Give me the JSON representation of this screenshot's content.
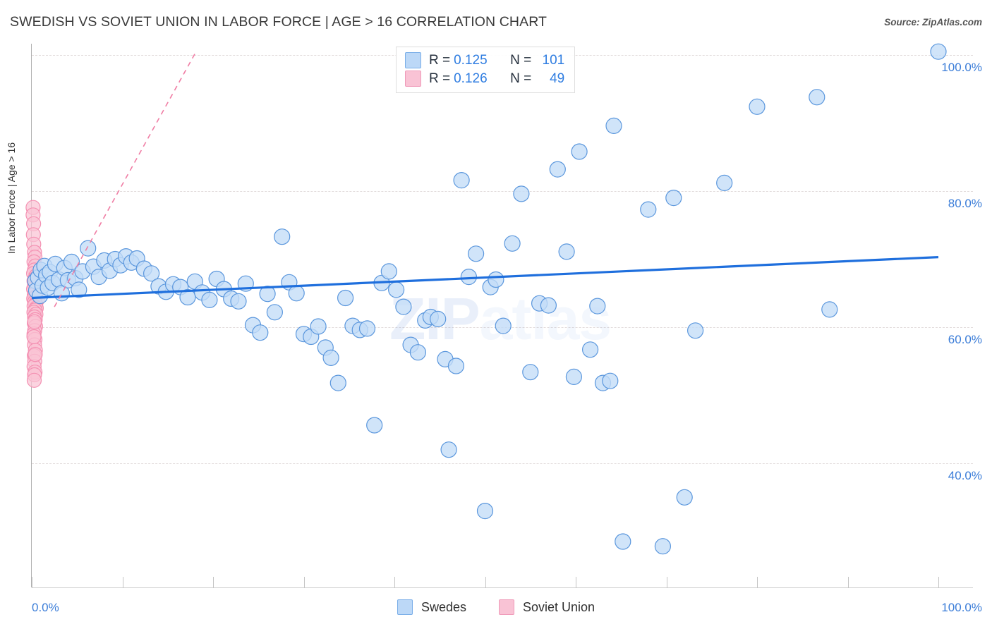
{
  "header": {
    "title": "SWEDISH VS SOVIET UNION IN LABOR FORCE | AGE > 16 CORRELATION CHART",
    "source": "Source: ZipAtlas.com"
  },
  "watermark": {
    "bold": "ZIP",
    "light": "atlas"
  },
  "stats": {
    "rows": [
      {
        "color": "#bcd8f7",
        "r_label": "R =",
        "r_value": "0.125",
        "n_label": "N =",
        "n_value": "101"
      },
      {
        "color": "#f9c3d5",
        "r_label": "R =",
        "r_value": "0.126",
        "n_label": "N =",
        "n_value": "49"
      }
    ]
  },
  "legend": {
    "items": [
      {
        "label": "Swedes",
        "color": "#bcd8f7"
      },
      {
        "label": "Soviet Union",
        "color": "#f9c3d5"
      }
    ]
  },
  "axes": {
    "y_title": "In Labor Force | Age > 16",
    "y_ticks": [
      {
        "label": "100.0%",
        "value": 100
      },
      {
        "label": "80.0%",
        "value": 80
      },
      {
        "label": "60.0%",
        "value": 60
      },
      {
        "label": "40.0%",
        "value": 40
      }
    ],
    "x_ticks": [
      {
        "label": "0.0%",
        "value": 0
      },
      {
        "label": "100.0%",
        "value": 100
      }
    ]
  },
  "chart_data": {
    "type": "scatter",
    "title": "SWEDISH VS SOVIET UNION IN LABOR FORCE | AGE > 16 CORRELATION CHART",
    "xlabel": "",
    "ylabel": "In Labor Force | Age > 16",
    "xlim": [
      0,
      100
    ],
    "ylim": [
      26,
      103
    ],
    "grid": true,
    "legend_position": "bottom-center",
    "series": [
      {
        "name": "Swedes",
        "color": "#bcd8f7",
        "r": 0.125,
        "n": 101,
        "trendline": {
          "x0": 0,
          "y0": 64.3,
          "x1": 100,
          "y1": 70.3,
          "style": "solid",
          "color": "#1f6fdd"
        },
        "points": [
          [
            0.4,
            66.8
          ],
          [
            0.5,
            65.4
          ],
          [
            0.7,
            67.3
          ],
          [
            0.9,
            64.6
          ],
          [
            1.0,
            68.4
          ],
          [
            1.2,
            66.1
          ],
          [
            1.4,
            69.0
          ],
          [
            1.6,
            67.6
          ],
          [
            1.8,
            65.8
          ],
          [
            2.0,
            68.1
          ],
          [
            2.3,
            66.5
          ],
          [
            2.6,
            69.3
          ],
          [
            3.0,
            67.0
          ],
          [
            3.3,
            65.0
          ],
          [
            3.6,
            68.7
          ],
          [
            4.0,
            66.9
          ],
          [
            4.4,
            69.6
          ],
          [
            4.8,
            67.2
          ],
          [
            5.2,
            65.5
          ],
          [
            5.6,
            68.2
          ],
          [
            6.2,
            71.6
          ],
          [
            6.8,
            68.9
          ],
          [
            7.4,
            67.4
          ],
          [
            8.0,
            69.8
          ],
          [
            8.6,
            68.3
          ],
          [
            9.2,
            70.0
          ],
          [
            9.8,
            69.1
          ],
          [
            10.4,
            70.4
          ],
          [
            11.0,
            69.5
          ],
          [
            11.6,
            70.1
          ],
          [
            12.4,
            68.6
          ],
          [
            13.2,
            67.9
          ],
          [
            14.0,
            66.0
          ],
          [
            14.8,
            65.2
          ],
          [
            15.6,
            66.3
          ],
          [
            16.4,
            65.9
          ],
          [
            17.2,
            64.4
          ],
          [
            18.0,
            66.7
          ],
          [
            18.8,
            65.1
          ],
          [
            19.6,
            64.0
          ],
          [
            20.4,
            67.1
          ],
          [
            21.2,
            65.6
          ],
          [
            22.0,
            64.2
          ],
          [
            22.8,
            63.8
          ],
          [
            23.6,
            66.4
          ],
          [
            24.4,
            60.3
          ],
          [
            25.2,
            59.2
          ],
          [
            26.0,
            64.9
          ],
          [
            26.8,
            62.2
          ],
          [
            27.6,
            73.3
          ],
          [
            28.4,
            66.6
          ],
          [
            29.2,
            65.0
          ],
          [
            30.0,
            59.0
          ],
          [
            30.8,
            58.6
          ],
          [
            31.6,
            60.1
          ],
          [
            32.4,
            57.0
          ],
          [
            33.0,
            55.5
          ],
          [
            33.8,
            51.8
          ],
          [
            34.6,
            64.3
          ],
          [
            35.4,
            60.2
          ],
          [
            36.2,
            59.6
          ],
          [
            37.0,
            59.8
          ],
          [
            37.8,
            45.6
          ],
          [
            38.6,
            66.5
          ],
          [
            39.4,
            68.2
          ],
          [
            40.2,
            65.5
          ],
          [
            41.0,
            63.0
          ],
          [
            41.8,
            57.4
          ],
          [
            42.6,
            56.3
          ],
          [
            43.4,
            61.0
          ],
          [
            44.0,
            61.5
          ],
          [
            44.8,
            61.2
          ],
          [
            45.6,
            55.3
          ],
          [
            46.0,
            42.0
          ],
          [
            46.8,
            54.3
          ],
          [
            47.4,
            81.6
          ],
          [
            48.2,
            67.4
          ],
          [
            49.0,
            70.8
          ],
          [
            50.0,
            33.0
          ],
          [
            50.6,
            65.9
          ],
          [
            51.2,
            67.0
          ],
          [
            52.0,
            60.2
          ],
          [
            53.0,
            72.3
          ],
          [
            54.0,
            79.6
          ],
          [
            55.0,
            53.4
          ],
          [
            56.0,
            63.5
          ],
          [
            57.0,
            63.2
          ],
          [
            58.0,
            83.2
          ],
          [
            59.0,
            71.1
          ],
          [
            59.8,
            52.7
          ],
          [
            60.4,
            85.8
          ],
          [
            61.6,
            56.7
          ],
          [
            62.4,
            63.1
          ],
          [
            63.0,
            51.8
          ],
          [
            63.8,
            52.1
          ],
          [
            64.2,
            89.6
          ],
          [
            65.2,
            28.5
          ],
          [
            68.0,
            77.3
          ],
          [
            69.6,
            27.8
          ],
          [
            70.8,
            79.0
          ],
          [
            72.0,
            35.0
          ],
          [
            73.2,
            59.5
          ],
          [
            76.4,
            81.2
          ],
          [
            80.0,
            92.4
          ],
          [
            86.6,
            93.8
          ],
          [
            88.0,
            62.6
          ],
          [
            100.0,
            100.5
          ]
        ]
      },
      {
        "name": "Soviet Union",
        "color": "#f9c3d5",
        "r": 0.126,
        "n": 49,
        "trendline": {
          "x0": 2.5,
          "y0": 63.0,
          "x1": 18.0,
          "y1": 100.2,
          "style": "dashed",
          "color": "#f07da4"
        },
        "points": [
          [
            0.15,
            77.6
          ],
          [
            0.15,
            76.5
          ],
          [
            0.2,
            75.2
          ],
          [
            0.18,
            73.6
          ],
          [
            0.22,
            72.2
          ],
          [
            0.3,
            71.0
          ],
          [
            0.35,
            70.3
          ],
          [
            0.25,
            69.6
          ],
          [
            0.4,
            69.0
          ],
          [
            0.3,
            68.4
          ],
          [
            0.2,
            67.9
          ],
          [
            0.45,
            67.5
          ],
          [
            0.35,
            67.1
          ],
          [
            0.25,
            66.8
          ],
          [
            0.5,
            66.5
          ],
          [
            0.3,
            66.2
          ],
          [
            0.4,
            65.9
          ],
          [
            0.2,
            65.6
          ],
          [
            0.55,
            65.3
          ],
          [
            0.35,
            65.0
          ],
          [
            0.28,
            64.8
          ],
          [
            0.45,
            64.5
          ],
          [
            0.22,
            64.2
          ],
          [
            0.6,
            64.0
          ],
          [
            0.32,
            63.7
          ],
          [
            0.42,
            63.4
          ],
          [
            0.26,
            63.1
          ],
          [
            0.5,
            62.8
          ],
          [
            0.36,
            62.5
          ],
          [
            0.24,
            62.2
          ],
          [
            0.46,
            61.9
          ],
          [
            0.3,
            61.5
          ],
          [
            0.38,
            61.1
          ],
          [
            0.28,
            60.6
          ],
          [
            0.42,
            60.1
          ],
          [
            0.32,
            59.5
          ],
          [
            0.25,
            59.0
          ],
          [
            0.35,
            58.2
          ],
          [
            0.3,
            57.4
          ],
          [
            0.4,
            56.6
          ],
          [
            0.28,
            55.8
          ],
          [
            0.33,
            55.0
          ],
          [
            0.26,
            54.2
          ],
          [
            0.36,
            53.4
          ],
          [
            0.3,
            60.8
          ],
          [
            0.24,
            58.6
          ],
          [
            0.38,
            56.0
          ],
          [
            0.3,
            53.0
          ],
          [
            0.27,
            52.2
          ]
        ]
      }
    ]
  }
}
